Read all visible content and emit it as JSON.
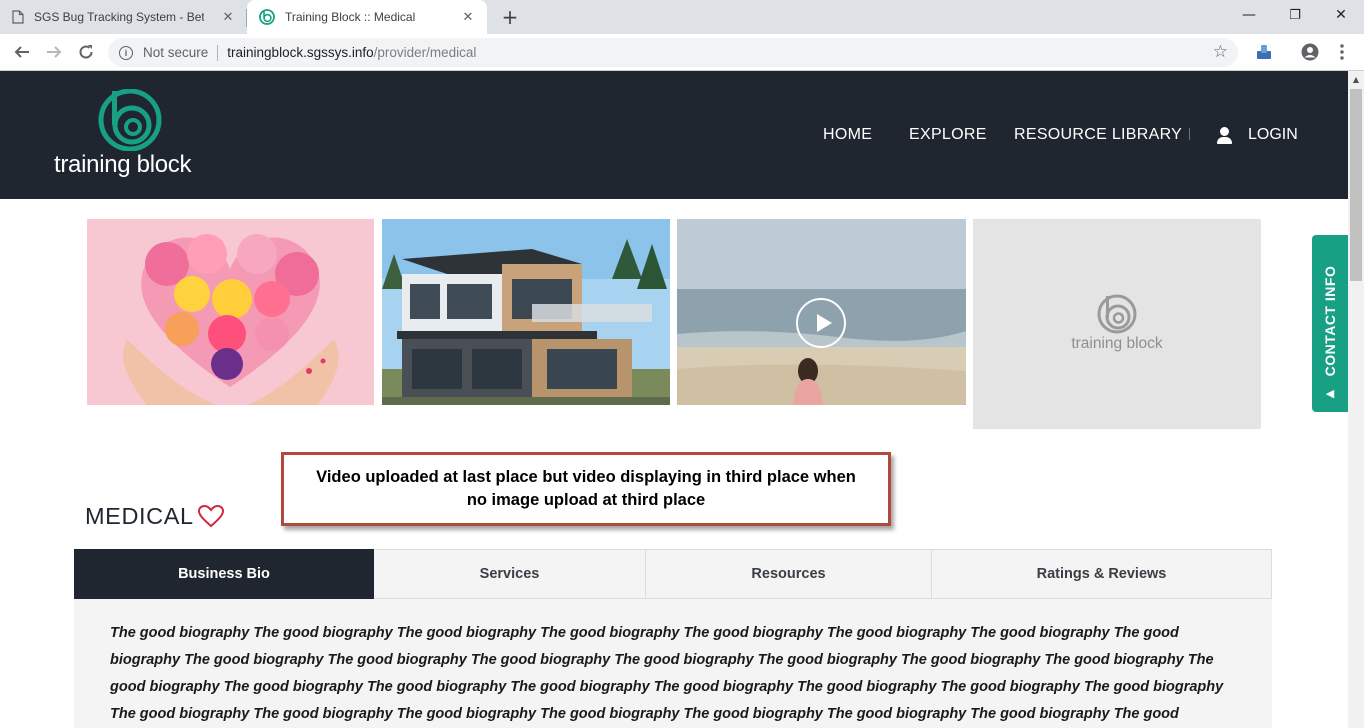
{
  "browser": {
    "tabs": [
      {
        "title": "SGS Bug Tracking System - Beta V",
        "active": false
      },
      {
        "title": "Training Block :: Medical",
        "active": true
      }
    ],
    "not_secure_label": "Not secure",
    "url_host": "trainingblock.sgssys.info",
    "url_path": "/provider/medical",
    "window_controls": {
      "minimize": "—",
      "restore": "❐",
      "close": "✕"
    }
  },
  "site": {
    "logo_text": "training block",
    "nav": [
      {
        "label": "HOME"
      },
      {
        "label": "EXPLORE"
      },
      {
        "label": "RESOURCE LIBRARY"
      }
    ],
    "login_label": "LOGIN",
    "brand_color": "#17a084",
    "header_color": "#1f2630"
  },
  "gallery": {
    "items": [
      {
        "kind": "image",
        "subject": "flower-heart"
      },
      {
        "kind": "image",
        "subject": "modern-house"
      },
      {
        "kind": "video",
        "subject": "beach"
      },
      {
        "kind": "placeholder",
        "logo_text": "training block"
      }
    ]
  },
  "contact_tab": {
    "label": "CONTACT INFO"
  },
  "annotation": {
    "text": "Video uploaded at last place but video displaying in third place when no image upload at third place"
  },
  "provider": {
    "title": "MEDICAL"
  },
  "tabs": [
    {
      "label": "Business Bio",
      "active": true
    },
    {
      "label": "Services",
      "active": false
    },
    {
      "label": "Resources",
      "active": false
    },
    {
      "label": "Ratings & Reviews",
      "active": false
    }
  ],
  "bio": {
    "text": "The good biography The good biography The good biography The good biography The good biography The good biography The good biography The good biography The good biography The good biography The good biography The good biography The good biography The good biography The good biography The good biography The good biography The good biography The good biography The good biography The good biography The good biography The good biography The good biography The good biography The good biography The good biography The good biography The good biography The good biography The good biography The good biography The good biography The good biography The good biography The good biography"
  }
}
